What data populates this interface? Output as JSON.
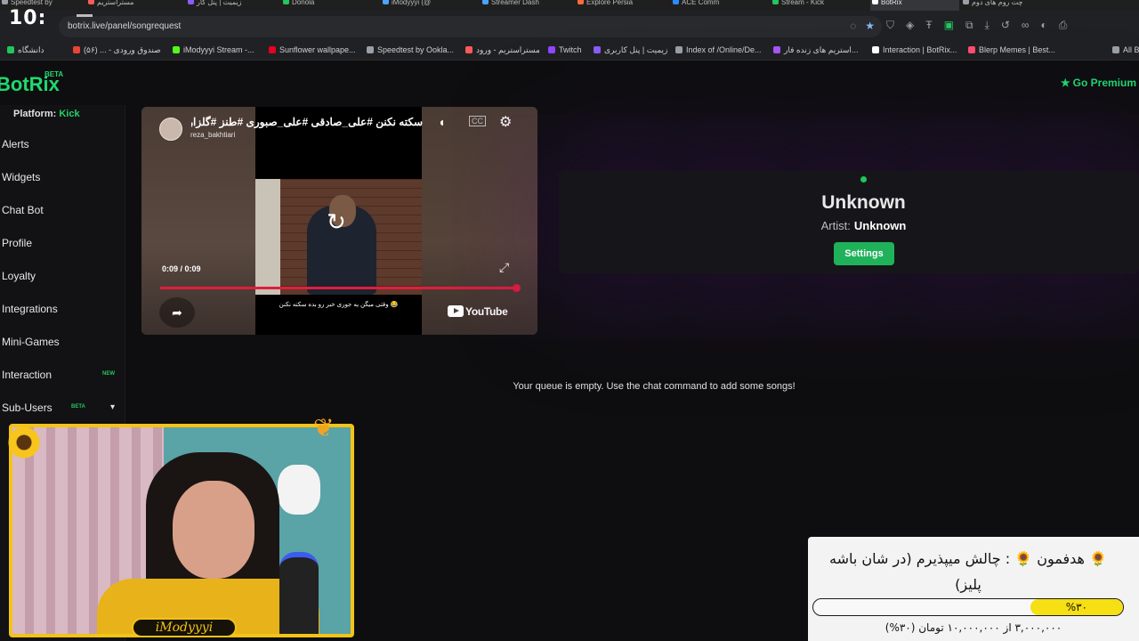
{
  "browser": {
    "clock": "10:",
    "tabs": [
      {
        "label": "Speedtest by",
        "color": "#9aa0a6"
      },
      {
        "label": "مستراستریم",
        "color": "#ff5a5a"
      },
      {
        "label": "زیمیت | پنل کار",
        "color": "#8a5cf6"
      },
      {
        "label": "Donola",
        "color": "#22c55e"
      },
      {
        "label": "iModyyyi (@",
        "color": "#4aa3ff"
      },
      {
        "label": "Streamer Dash",
        "color": "#4aa3ff"
      },
      {
        "label": "Explore Persia",
        "color": "#ff6b3d"
      },
      {
        "label": "ACE Comm",
        "color": "#2a8bff"
      },
      {
        "label": "Stream - Kick",
        "color": "#22c55e"
      },
      {
        "label": "BotRix",
        "color": "#ffffff"
      },
      {
        "label": "چت روم های دوم",
        "color": "#9aa0a6"
      }
    ],
    "url": "botrix.live/panel/songrequest",
    "bookmarks": [
      {
        "label": "دانشگاه",
        "color": "#22c55e"
      },
      {
        "label": "صندوق ورودی - ... (۵۶)",
        "color": "#ea4335"
      },
      {
        "label": "iModyyyi Stream -...",
        "color": "#53fc18"
      },
      {
        "label": "Sunflower wallpape...",
        "color": "#e60023"
      },
      {
        "label": "Speedtest by Ookla...",
        "color": "#9aa0a6"
      },
      {
        "label": "مستراستریم - ورود",
        "color": "#ff5a5a"
      },
      {
        "label": "Twitch",
        "color": "#9146ff"
      },
      {
        "label": "زیمیت | پنل کاربری",
        "color": "#8a5cf6"
      },
      {
        "label": "Index of /Online/De...",
        "color": "#9aa0a6"
      },
      {
        "label": "استریم های زنده فار...",
        "color": "#a855f7"
      },
      {
        "label": "Interaction | BotRix...",
        "color": "#ffffff"
      },
      {
        "label": "Blerp Memes | Best...",
        "color": "#ff4d6d"
      },
      {
        "label": "All B",
        "color": "#9aa0a6"
      }
    ]
  },
  "app": {
    "logo": "BotRix",
    "logo_badge": "BETA",
    "premium_label": "Go Premium",
    "platform_label": "Platform:",
    "platform_value": "Kick",
    "nav": [
      {
        "label": "Alerts"
      },
      {
        "label": "Widgets"
      },
      {
        "label": "Chat Bot"
      },
      {
        "label": "Profile"
      },
      {
        "label": "Loyalty"
      },
      {
        "label": "Integrations"
      },
      {
        "label": "Mini-Games"
      },
      {
        "label": "Interaction",
        "badge": "NEW",
        "badge_color": "#22c55e"
      },
      {
        "label": "Sub-Users",
        "badge": "BETA",
        "badge_color": "#22c55e"
      }
    ]
  },
  "video": {
    "title": "سکته نکنن #علی_صادقی #علی_صبوری #طنز #گلزار",
    "channel": "reza_bakhtiari",
    "subtitle": "وقتی میگن یه جوری خبر رو بده سکته نکنن 😂",
    "time": "0:09 / 0:09",
    "progress": 1.0,
    "brand": "YouTube"
  },
  "now_playing": {
    "title": "Unknown",
    "artist_label": "Artist:",
    "artist": "Unknown",
    "settings_label": "Settings"
  },
  "queue": {
    "empty_message": "Your queue is empty. Use the chat command to add some songs!"
  },
  "webcam": {
    "name": "iModyyyi"
  },
  "donation_goal": {
    "text": "🌻 هدفمون 🌻 : چالش میپذیرم (در شان باشه پلیز)",
    "percent_label": "%۳۰",
    "progress": 0.3,
    "amount_text": "۳,۰۰۰,۰۰۰ از ۱۰,۰۰۰,۰۰۰ تومان (۳۰%)"
  },
  "colors": {
    "accent_green": "#1fd96e",
    "goal_yellow": "#f6df12",
    "frame_yellow": "#f3c316"
  }
}
